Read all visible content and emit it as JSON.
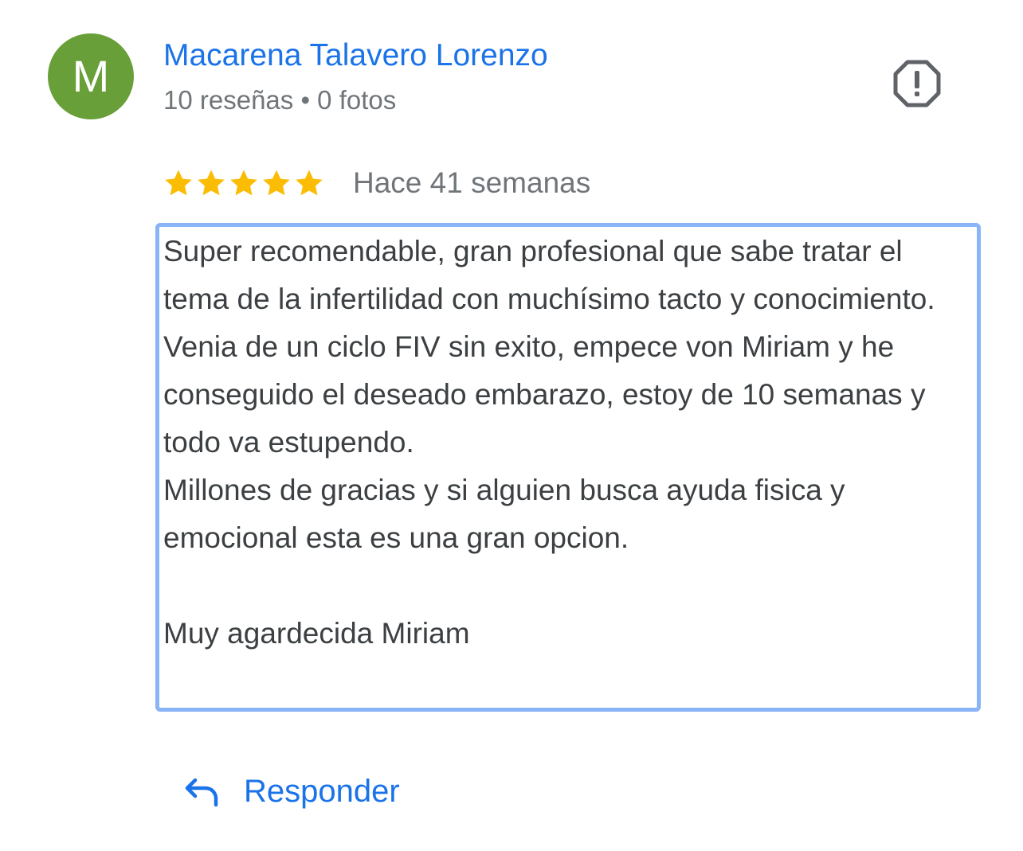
{
  "author": {
    "initial": "M",
    "name": "Macarena Talavero Lorenzo",
    "meta": "10 reseñas • 0 fotos",
    "avatar_color": "#689f38"
  },
  "report": {
    "icon": "report-icon"
  },
  "review": {
    "rating": 5,
    "max_rating": 5,
    "star_color": "#fbbc04",
    "date": "Hace 41 semanas",
    "paragraphs": [
      "Super recomendable, gran profesional que sabe tratar el tema de la infertilidad con muchísimo tacto y conocimiento. Venia de un ciclo FIV sin exito, empece von Miriam y he conseguido el deseado embarazo, estoy de 10 semanas y todo va estupendo.\nMillones de gracias y si alguien busca ayuda fisica y emocional esta es una gran opcion.",
      "",
      "Muy agardecida Miriam"
    ]
  },
  "actions": {
    "reply_label": "Responder",
    "reply_icon": "reply-arrow-icon"
  },
  "colors": {
    "link_blue": "#1a73e8",
    "focus_border": "#8ab4f8",
    "secondary_text": "#70757a",
    "body_text": "#3c4043"
  }
}
